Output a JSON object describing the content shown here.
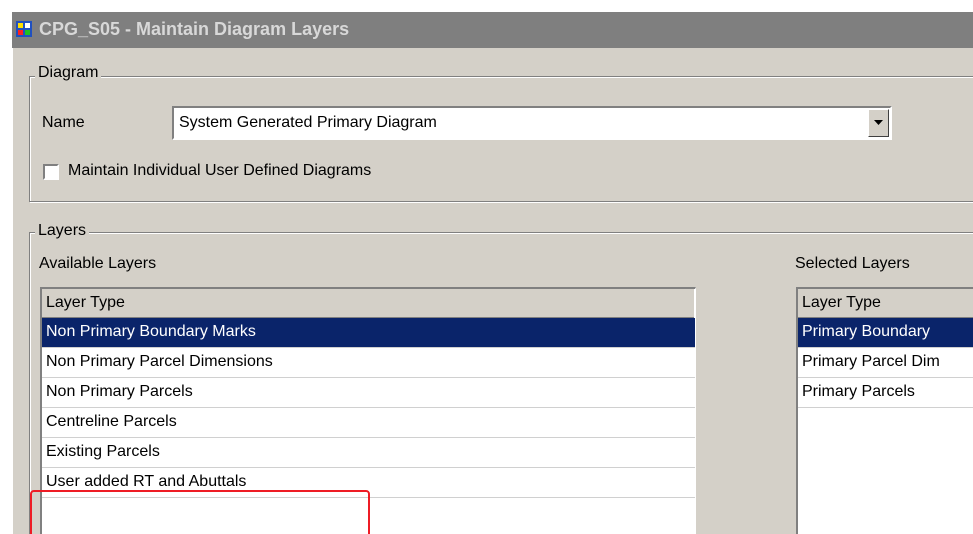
{
  "window": {
    "title": "CPG_S05 - Maintain Diagram Layers",
    "icon": "diagram-app-icon"
  },
  "diagram_group": {
    "legend": "Diagram",
    "name_label": "Name",
    "name_value": "System Generated Primary Diagram",
    "checkbox_label": "Maintain Individual User Defined Diagrams",
    "checkbox_checked": false
  },
  "layers_group": {
    "legend": "Layers",
    "available": {
      "label": "Available Layers",
      "column_header": "Layer Type",
      "rows": [
        "Non Primary Boundary Marks",
        "Non Primary Parcel Dimensions",
        "Non Primary Parcels",
        "Centreline Parcels",
        "Existing Parcels",
        "User added RT and Abuttals"
      ],
      "selected_index": 0
    },
    "selected": {
      "label": "Selected Layers",
      "column_header": "Layer Type",
      "rows": [
        "Primary Boundary",
        "Primary Parcel Dim",
        "Primary Parcels"
      ],
      "selected_index": 0
    }
  },
  "colors": {
    "selection": "#0a246a",
    "annotation": "#ee1c25",
    "face": "#d4d0c8",
    "titlebar": "#7f7f7f"
  }
}
